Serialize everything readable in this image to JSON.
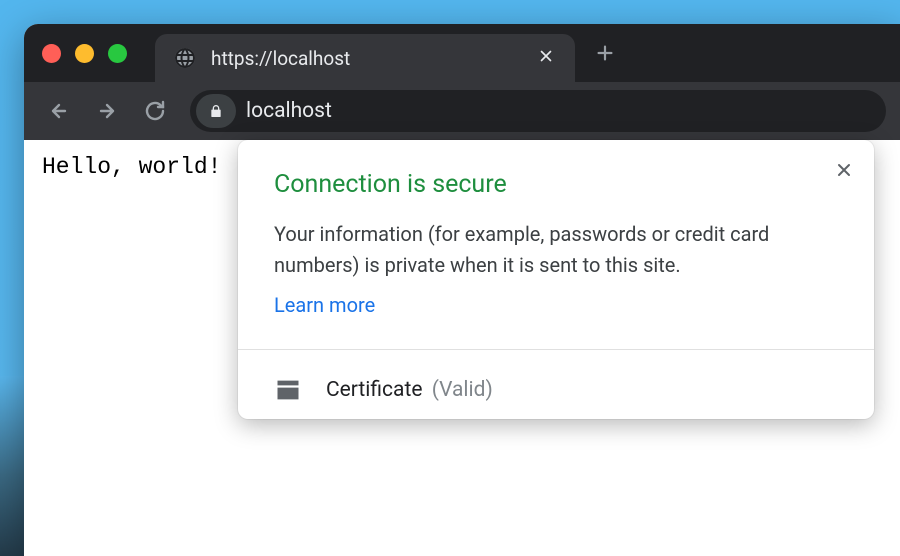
{
  "tab": {
    "title": "https://localhost",
    "favicon": "globe-icon"
  },
  "nav": {
    "back_enabled": false,
    "forward_enabled": false
  },
  "omnibox": {
    "display_url": "localhost",
    "security": "secure"
  },
  "page": {
    "body_text": "Hello, world!"
  },
  "site_info": {
    "title": "Connection is secure",
    "description": "Your information (for example, passwords or credit card numbers) is private when it is sent to this site.",
    "learn_more_label": "Learn more",
    "certificate_label": "Certificate",
    "certificate_status": "(Valid)"
  },
  "colors": {
    "secure_green": "#1e8e3e",
    "link_blue": "#1a73e8",
    "chrome_dark": "#202124",
    "chrome_dark2": "#35363a"
  }
}
